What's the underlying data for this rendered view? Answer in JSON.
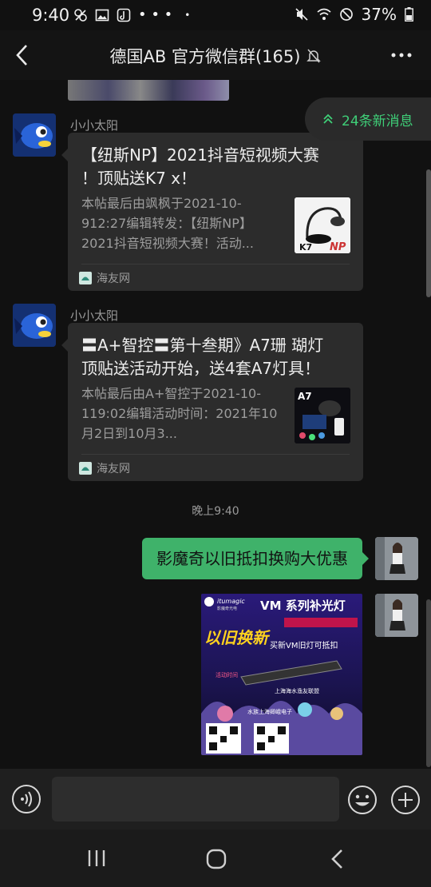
{
  "status_bar": {
    "time": "9:40",
    "battery": "37%",
    "icons_left": [
      "no-data-icon",
      "image-icon",
      "tiktok-icon",
      "more-notifications-icon",
      "dot-icon"
    ],
    "icons_right": [
      "mute-icon",
      "wifi-icon",
      "do-not-disturb-icon",
      "battery-icon"
    ]
  },
  "header": {
    "title": "德国AB 官方微信群(165)",
    "muted_icon": "bell-off-icon"
  },
  "new_messages": {
    "label": "24条新消息",
    "icon": "double-chevron-up-icon",
    "color": "#3fcf78"
  },
  "messages": [
    {
      "type": "link_card",
      "sender": "小小太阳",
      "title": "【纽斯NP】2021抖音短视频大赛 ！顶贴送K7 x！",
      "description": "本帖最后由飒枫于2021-10-912:27编辑转发：【纽斯NP】2021抖音短视频大赛！活动...",
      "source": "海友网",
      "thumb_labels": [
        "K7",
        "NP"
      ]
    },
    {
      "type": "link_card",
      "sender": "小小太阳",
      "title": "〓A+智控〓第十叁期》A7珊 瑚灯顶贴送活动开始，送4套A7灯具！",
      "description": "本帖最后由A+智控于2021-10-119:02编辑活动时间：2021年10月2日到10月3...",
      "source": "海友网",
      "thumb_labels": [
        "A7"
      ]
    },
    {
      "type": "timestamp",
      "text": "晚上9:40"
    },
    {
      "type": "text_self",
      "text": "影魔奇以旧抵扣换购大优惠"
    },
    {
      "type": "image_self",
      "poster": {
        "brand": "itumagic",
        "brand_sub": "影魔奇光电",
        "headline": "VM 系列补光灯",
        "line2": "以旧换新",
        "line3": "买新VM旧灯可抵扣",
        "line4": "上海海水渔友联盟",
        "line5": "水族上海卿峨电子"
      }
    }
  ],
  "input_bar": {
    "placeholder": ""
  },
  "colors": {
    "background": "#111111",
    "bubble_self": "#3fb26a",
    "card": "#2c2c2c"
  }
}
